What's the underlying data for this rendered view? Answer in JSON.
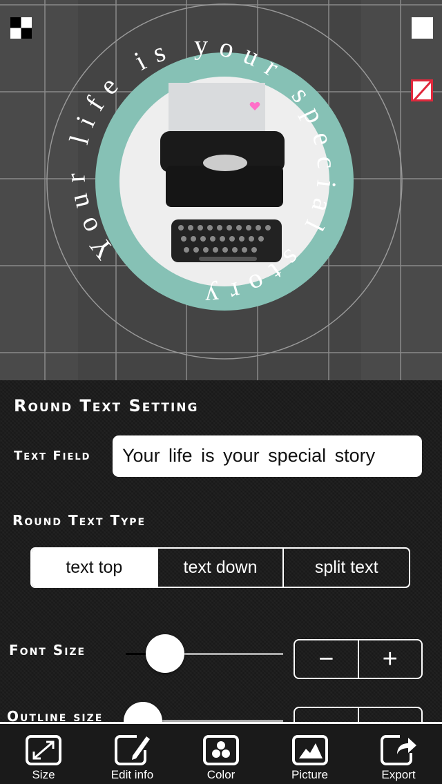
{
  "canvas": {
    "curved_text": "Your life is your special story",
    "ring_color": "#86c1b5",
    "icons": [
      "transparency-checker-icon",
      "white-background-icon",
      "no-color-icon"
    ]
  },
  "panel": {
    "title": "Round Text Setting",
    "text_field": {
      "label": "Text Field",
      "value": "Your life is your special story"
    },
    "round_text_type": {
      "label": "Round Text Type",
      "options": [
        "text top",
        "text down",
        "split text"
      ],
      "selected": "text top"
    },
    "font_size": {
      "label": "Font Size",
      "slider_fraction": 0.25,
      "minus": "−",
      "plus": "+"
    },
    "outline_size": {
      "label": "Outline size",
      "slider_fraction": 0.1
    }
  },
  "tabbar": {
    "items": [
      {
        "label": "Size",
        "icon": "resize-icon"
      },
      {
        "label": "Edit info",
        "icon": "edit-icon"
      },
      {
        "label": "Color",
        "icon": "color-icon"
      },
      {
        "label": "Picture",
        "icon": "picture-icon"
      },
      {
        "label": "Export",
        "icon": "export-icon"
      }
    ]
  }
}
